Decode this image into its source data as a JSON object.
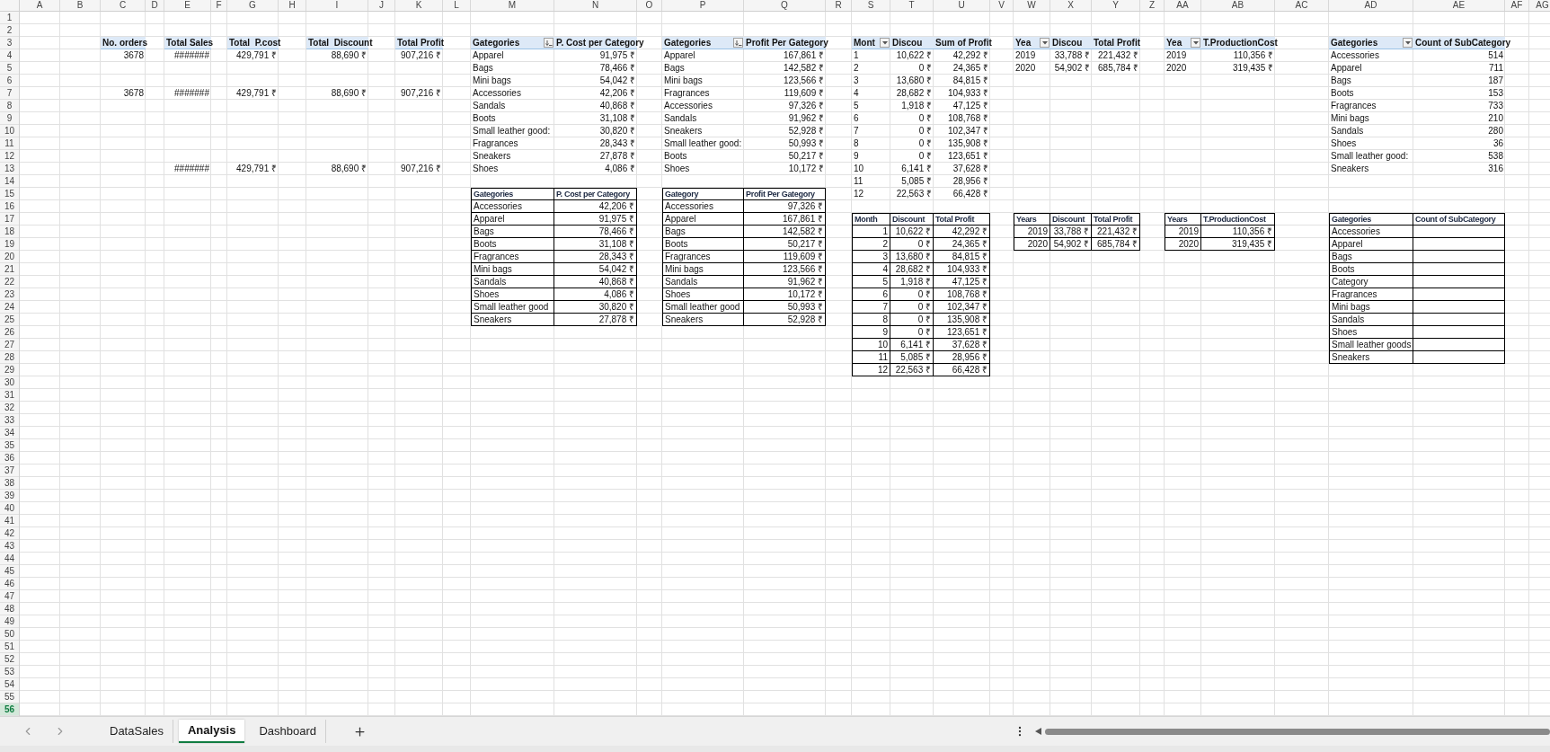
{
  "sheet": {
    "columns": [
      "A",
      "B",
      "C",
      "D",
      "E",
      "F",
      "G",
      "H",
      "I",
      "J",
      "K",
      "L",
      "M",
      "N",
      "O",
      "P",
      "Q",
      "R",
      "S",
      "T",
      "U",
      "V",
      "W",
      "X",
      "Y",
      "Z",
      "AA",
      "AB",
      "AC",
      "AD",
      "AE",
      "AF",
      "AG"
    ],
    "rows": [
      {
        "label": "1",
        "selected": false
      },
      {
        "label": "2",
        "selected": false
      },
      {
        "label": "3",
        "selected": false,
        "cells": [
          null,
          null,
          {
            "text": "No. orders",
            "kind": "heading"
          },
          null,
          {
            "text": "Total Sales",
            "kind": "heading"
          },
          null,
          {
            "text": "Total  P.cost",
            "kind": "heading"
          },
          null,
          {
            "text": "Total  Discount",
            "kind": "heading"
          },
          null,
          {
            "text": "Total Profit",
            "kind": "heading"
          },
          null,
          {
            "text": "Gategories",
            "kind": "sort-heading"
          },
          {
            "text": "P. Cost per Category",
            "kind": "heading"
          },
          null,
          {
            "text": "Gategories",
            "kind": "sort-heading"
          },
          {
            "text": "Profit Per Gategory",
            "kind": "heading"
          },
          null,
          {
            "text": "Mont",
            "kind": "filter-heading"
          },
          {
            "text": "Discou",
            "kind": "heading"
          },
          {
            "text": "Sum of Profit",
            "kind": "heading"
          },
          null,
          {
            "text": "Yea",
            "kind": "filter-heading"
          },
          {
            "text": "Discou",
            "kind": "heading"
          },
          {
            "text": "Total Profit",
            "kind": "heading"
          },
          null,
          {
            "text": "Yea",
            "kind": "filter-heading"
          },
          {
            "text": "T.ProductionCost",
            "kind": "heading"
          },
          null,
          {
            "text": "Gategories",
            "kind": "filter-heading"
          },
          {
            "text": "Count of SubCategory",
            "kind": "heading"
          }
        ]
      },
      {
        "label": "4",
        "selected": false,
        "cells": [
          null,
          null,
          {
            "text": "3678",
            "kind": "number"
          },
          null,
          {
            "text": "#######",
            "kind": "number"
          },
          null,
          {
            "text": "429,791 ₹",
            "kind": "number"
          },
          null,
          {
            "text": "88,690 ₹",
            "kind": "number"
          },
          null,
          {
            "text": "907,216 ₹",
            "kind": "number"
          },
          null,
          {
            "text": "Apparel",
            "kind": "text"
          },
          {
            "text": "91,975 ₹",
            "kind": "number"
          },
          null,
          {
            "text": "Apparel",
            "kind": "text"
          },
          {
            "text": "167,861 ₹",
            "kind": "number"
          },
          null,
          {
            "text": "1",
            "kind": "text"
          },
          {
            "text": "10,622 ₹",
            "kind": "number"
          },
          {
            "text": "42,292 ₹",
            "kind": "number"
          },
          null,
          {
            "text": "2019",
            "kind": "text"
          },
          {
            "text": "33,788 ₹",
            "kind": "number"
          },
          {
            "text": "221,432 ₹",
            "kind": "number"
          },
          null,
          {
            "text": "2019",
            "kind": "text"
          },
          {
            "text": "110,356 ₹",
            "kind": "number"
          },
          null,
          {
            "text": "Accessories",
            "kind": "text"
          },
          {
            "text": "514",
            "kind": "number"
          }
        ]
      },
      {
        "label": "5",
        "selected": false,
        "cells": [
          null,
          null,
          null,
          null,
          null,
          null,
          null,
          null,
          null,
          null,
          null,
          null,
          {
            "text": "Bags",
            "kind": "text"
          },
          {
            "text": "78,466 ₹",
            "kind": "number"
          },
          null,
          {
            "text": "Bags",
            "kind": "text"
          },
          {
            "text": "142,582 ₹",
            "kind": "number"
          },
          null,
          {
            "text": "2",
            "kind": "text"
          },
          {
            "text": "0 ₹",
            "kind": "number"
          },
          {
            "text": "24,365 ₹",
            "kind": "number"
          },
          null,
          {
            "text": "2020",
            "kind": "text"
          },
          {
            "text": "54,902 ₹",
            "kind": "number"
          },
          {
            "text": "685,784 ₹",
            "kind": "number"
          },
          null,
          {
            "text": "2020",
            "kind": "text"
          },
          {
            "text": "319,435 ₹",
            "kind": "number"
          },
          null,
          {
            "text": "Apparel",
            "kind": "text"
          },
          {
            "text": "711",
            "kind": "number"
          }
        ]
      },
      {
        "label": "6",
        "selected": false,
        "cells": [
          null,
          null,
          null,
          null,
          null,
          null,
          null,
          null,
          null,
          null,
          null,
          null,
          {
            "text": "Mini bags",
            "kind": "text"
          },
          {
            "text": "54,042 ₹",
            "kind": "number"
          },
          null,
          {
            "text": "Mini bags",
            "kind": "text"
          },
          {
            "text": "123,566 ₹",
            "kind": "number"
          },
          null,
          {
            "text": "3",
            "kind": "text"
          },
          {
            "text": "13,680 ₹",
            "kind": "number"
          },
          {
            "text": "84,815 ₹",
            "kind": "number"
          },
          null,
          null,
          null,
          null,
          null,
          null,
          null,
          null,
          {
            "text": "Bags",
            "kind": "text"
          },
          {
            "text": "187",
            "kind": "number"
          }
        ]
      },
      {
        "label": "7",
        "selected": false,
        "cells": [
          null,
          null,
          {
            "text": "3678",
            "kind": "number"
          },
          null,
          {
            "text": "#######",
            "kind": "number"
          },
          null,
          {
            "text": "429,791 ₹",
            "kind": "number"
          },
          null,
          {
            "text": "88,690 ₹",
            "kind": "number"
          },
          null,
          {
            "text": "907,216 ₹",
            "kind": "number"
          },
          null,
          {
            "text": "Accessories",
            "kind": "text"
          },
          {
            "text": "42,206 ₹",
            "kind": "number"
          },
          null,
          {
            "text": "Fragrances",
            "kind": "text"
          },
          {
            "text": "119,609 ₹",
            "kind": "number"
          },
          null,
          {
            "text": "4",
            "kind": "text"
          },
          {
            "text": "28,682 ₹",
            "kind": "number"
          },
          {
            "text": "104,933 ₹",
            "kind": "number"
          },
          null,
          null,
          null,
          null,
          null,
          null,
          null,
          null,
          {
            "text": "Boots",
            "kind": "text"
          },
          {
            "text": "153",
            "kind": "number"
          }
        ]
      },
      {
        "label": "8",
        "selected": false,
        "cells": [
          null,
          null,
          null,
          null,
          null,
          null,
          null,
          null,
          null,
          null,
          null,
          null,
          {
            "text": "Sandals",
            "kind": "text"
          },
          {
            "text": "40,868 ₹",
            "kind": "number"
          },
          null,
          {
            "text": "Accessories",
            "kind": "text"
          },
          {
            "text": "97,326 ₹",
            "kind": "number"
          },
          null,
          {
            "text": "5",
            "kind": "text"
          },
          {
            "text": "1,918 ₹",
            "kind": "number"
          },
          {
            "text": "47,125 ₹",
            "kind": "number"
          },
          null,
          null,
          null,
          null,
          null,
          null,
          null,
          null,
          {
            "text": "Fragrances",
            "kind": "text"
          },
          {
            "text": "733",
            "kind": "number"
          }
        ]
      },
      {
        "label": "9",
        "selected": false,
        "cells": [
          null,
          null,
          null,
          null,
          null,
          null,
          null,
          null,
          null,
          null,
          null,
          null,
          {
            "text": "Boots",
            "kind": "text"
          },
          {
            "text": "31,108 ₹",
            "kind": "number"
          },
          null,
          {
            "text": "Sandals",
            "kind": "text"
          },
          {
            "text": "91,962 ₹",
            "kind": "number"
          },
          null,
          {
            "text": "6",
            "kind": "text"
          },
          {
            "text": "0 ₹",
            "kind": "number"
          },
          {
            "text": "108,768 ₹",
            "kind": "number"
          },
          null,
          null,
          null,
          null,
          null,
          null,
          null,
          null,
          {
            "text": "Mini bags",
            "kind": "text"
          },
          {
            "text": "210",
            "kind": "number"
          }
        ]
      },
      {
        "label": "10",
        "selected": false,
        "cells": [
          null,
          null,
          null,
          null,
          null,
          null,
          null,
          null,
          null,
          null,
          null,
          null,
          {
            "text": "Small leather good:",
            "kind": "text"
          },
          {
            "text": "30,820 ₹",
            "kind": "number"
          },
          null,
          {
            "text": "Sneakers",
            "kind": "text"
          },
          {
            "text": "52,928 ₹",
            "kind": "number"
          },
          null,
          {
            "text": "7",
            "kind": "text"
          },
          {
            "text": "0 ₹",
            "kind": "number"
          },
          {
            "text": "102,347 ₹",
            "kind": "number"
          },
          null,
          null,
          null,
          null,
          null,
          null,
          null,
          null,
          {
            "text": "Sandals",
            "kind": "text"
          },
          {
            "text": "280",
            "kind": "number"
          }
        ]
      },
      {
        "label": "11",
        "selected": false,
        "cells": [
          null,
          null,
          null,
          null,
          null,
          null,
          null,
          null,
          null,
          null,
          null,
          null,
          {
            "text": "Fragrances",
            "kind": "text"
          },
          {
            "text": "28,343 ₹",
            "kind": "number"
          },
          null,
          {
            "text": "Small leather good:",
            "kind": "text"
          },
          {
            "text": "50,993 ₹",
            "kind": "number"
          },
          null,
          {
            "text": "8",
            "kind": "text"
          },
          {
            "text": "0 ₹",
            "kind": "number"
          },
          {
            "text": "135,908 ₹",
            "kind": "number"
          },
          null,
          null,
          null,
          null,
          null,
          null,
          null,
          null,
          {
            "text": "Shoes",
            "kind": "text"
          },
          {
            "text": "36",
            "kind": "number"
          }
        ]
      },
      {
        "label": "12",
        "selected": false,
        "cells": [
          null,
          null,
          null,
          null,
          null,
          null,
          null,
          null,
          null,
          null,
          null,
          null,
          {
            "text": "Sneakers",
            "kind": "text"
          },
          {
            "text": "27,878 ₹",
            "kind": "number"
          },
          null,
          {
            "text": "Boots",
            "kind": "text"
          },
          {
            "text": "50,217 ₹",
            "kind": "number"
          },
          null,
          {
            "text": "9",
            "kind": "text"
          },
          {
            "text": "0 ₹",
            "kind": "number"
          },
          {
            "text": "123,651 ₹",
            "kind": "number"
          },
          null,
          null,
          null,
          null,
          null,
          null,
          null,
          null,
          {
            "text": "Small leather good:",
            "kind": "text"
          },
          {
            "text": "538",
            "kind": "number"
          }
        ]
      },
      {
        "label": "13",
        "selected": false,
        "cells": [
          null,
          null,
          null,
          null,
          {
            "text": "#######",
            "kind": "number"
          },
          null,
          {
            "text": "429,791 ₹",
            "kind": "number"
          },
          null,
          {
            "text": "88,690 ₹",
            "kind": "number"
          },
          null,
          {
            "text": "907,216 ₹",
            "kind": "number"
          },
          null,
          {
            "text": "Shoes",
            "kind": "text"
          },
          {
            "text": "4,086 ₹",
            "kind": "number"
          },
          null,
          {
            "text": "Shoes",
            "kind": "text"
          },
          {
            "text": "10,172 ₹",
            "kind": "number"
          },
          null,
          {
            "text": "10",
            "kind": "text"
          },
          {
            "text": "6,141 ₹",
            "kind": "number"
          },
          {
            "text": "37,628 ₹",
            "kind": "number"
          },
          null,
          null,
          null,
          null,
          null,
          null,
          null,
          null,
          {
            "text": "Sneakers",
            "kind": "text"
          },
          {
            "text": "316",
            "kind": "number"
          }
        ]
      },
      {
        "label": "14",
        "selected": false,
        "cells": [
          null,
          null,
          null,
          null,
          null,
          null,
          null,
          null,
          null,
          null,
          null,
          null,
          null,
          null,
          null,
          null,
          null,
          null,
          {
            "text": "11",
            "kind": "text"
          },
          {
            "text": "5,085 ₹",
            "kind": "number"
          },
          {
            "text": "28,956 ₹",
            "kind": "number"
          }
        ]
      },
      {
        "label": "15",
        "selected": false,
        "cells": [
          null,
          null,
          null,
          null,
          null,
          null,
          null,
          null,
          null,
          null,
          null,
          null,
          {
            "text": "Gategories",
            "kind": "box-heading"
          },
          {
            "text": "P. Cost per Category",
            "kind": "box-heading"
          },
          null,
          {
            "text": "Gategory",
            "kind": "box-heading"
          },
          {
            "text": "Profit Per Gategory",
            "kind": "box-heading"
          },
          null,
          {
            "text": "12",
            "kind": "text"
          },
          {
            "text": "22,563 ₹",
            "kind": "number"
          },
          {
            "text": "66,428 ₹",
            "kind": "number"
          }
        ]
      },
      {
        "label": "16",
        "selected": false,
        "cells": [
          null,
          null,
          null,
          null,
          null,
          null,
          null,
          null,
          null,
          null,
          null,
          null,
          {
            "text": "Accessories",
            "kind": "box-text"
          },
          {
            "text": "42,206 ₹",
            "kind": "box-number"
          },
          null,
          {
            "text": "Accessories",
            "kind": "box-text"
          },
          {
            "text": "97,326 ₹",
            "kind": "box-number"
          }
        ]
      },
      {
        "label": "17",
        "selected": false,
        "cells": [
          null,
          null,
          null,
          null,
          null,
          null,
          null,
          null,
          null,
          null,
          null,
          null,
          {
            "text": "Apparel",
            "kind": "box-text"
          },
          {
            "text": "91,975 ₹",
            "kind": "box-number"
          },
          null,
          {
            "text": "Apparel",
            "kind": "box-text"
          },
          {
            "text": "167,861 ₹",
            "kind": "box-number"
          },
          null,
          {
            "text": "Month",
            "kind": "box-heading"
          },
          {
            "text": "Discount",
            "kind": "box-heading"
          },
          {
            "text": "Total Profit",
            "kind": "box-heading"
          },
          null,
          {
            "text": "Years",
            "kind": "box-heading"
          },
          {
            "text": "Discount",
            "kind": "box-heading"
          },
          {
            "text": "Total Profit",
            "kind": "box-heading"
          },
          null,
          {
            "text": "Years",
            "kind": "box-heading"
          },
          {
            "text": "T.ProductionCost",
            "kind": "box-heading"
          },
          null,
          {
            "text": "Gategories",
            "kind": "box-heading"
          },
          {
            "text": "Count of SubCategory",
            "kind": "box-heading"
          }
        ]
      },
      {
        "label": "18",
        "selected": false,
        "cells": [
          null,
          null,
          null,
          null,
          null,
          null,
          null,
          null,
          null,
          null,
          null,
          null,
          {
            "text": "Bags",
            "kind": "box-text"
          },
          {
            "text": "78,466 ₹",
            "kind": "box-number"
          },
          null,
          {
            "text": "Bags",
            "kind": "box-text"
          },
          {
            "text": "142,582 ₹",
            "kind": "box-number"
          },
          null,
          {
            "text": "1",
            "kind": "box-number"
          },
          {
            "text": "10,622 ₹",
            "kind": "box-number"
          },
          {
            "text": "42,292 ₹",
            "kind": "box-number"
          },
          null,
          {
            "text": "2019",
            "kind": "box-number"
          },
          {
            "text": "33,788 ₹",
            "kind": "box-number"
          },
          {
            "text": "221,432 ₹",
            "kind": "box-number"
          },
          null,
          {
            "text": "2019",
            "kind": "box-number"
          },
          {
            "text": "110,356 ₹",
            "kind": "box-number"
          },
          null,
          {
            "text": "Accessories",
            "kind": "box-text"
          },
          {
            "kind": "box-empty"
          }
        ]
      },
      {
        "label": "19",
        "selected": false,
        "cells": [
          null,
          null,
          null,
          null,
          null,
          null,
          null,
          null,
          null,
          null,
          null,
          null,
          {
            "text": "Boots",
            "kind": "box-text"
          },
          {
            "text": "31,108 ₹",
            "kind": "box-number"
          },
          null,
          {
            "text": "Boots",
            "kind": "box-text"
          },
          {
            "text": "50,217 ₹",
            "kind": "box-number"
          },
          null,
          {
            "text": "2",
            "kind": "box-number"
          },
          {
            "text": "0 ₹",
            "kind": "box-number"
          },
          {
            "text": "24,365 ₹",
            "kind": "box-number"
          },
          null,
          {
            "text": "2020",
            "kind": "box-number"
          },
          {
            "text": "54,902 ₹",
            "kind": "box-number"
          },
          {
            "text": "685,784 ₹",
            "kind": "box-number"
          },
          null,
          {
            "text": "2020",
            "kind": "box-number"
          },
          {
            "text": "319,435 ₹",
            "kind": "box-number"
          },
          null,
          {
            "text": "Apparel",
            "kind": "box-text"
          },
          {
            "kind": "box-empty"
          }
        ]
      },
      {
        "label": "20",
        "selected": false,
        "cells": [
          null,
          null,
          null,
          null,
          null,
          null,
          null,
          null,
          null,
          null,
          null,
          null,
          {
            "text": "Fragrances",
            "kind": "box-text"
          },
          {
            "text": "28,343 ₹",
            "kind": "box-number"
          },
          null,
          {
            "text": "Fragrances",
            "kind": "box-text"
          },
          {
            "text": "119,609 ₹",
            "kind": "box-number"
          },
          null,
          {
            "text": "3",
            "kind": "box-number"
          },
          {
            "text": "13,680 ₹",
            "kind": "box-number"
          },
          {
            "text": "84,815 ₹",
            "kind": "box-number"
          },
          null,
          null,
          null,
          null,
          null,
          null,
          null,
          null,
          {
            "text": "Bags",
            "kind": "box-text"
          },
          {
            "kind": "box-empty"
          }
        ]
      },
      {
        "label": "21",
        "selected": false,
        "cells": [
          null,
          null,
          null,
          null,
          null,
          null,
          null,
          null,
          null,
          null,
          null,
          null,
          {
            "text": "Mini bags",
            "kind": "box-text"
          },
          {
            "text": "54,042 ₹",
            "kind": "box-number"
          },
          null,
          {
            "text": "Mini bags",
            "kind": "box-text"
          },
          {
            "text": "123,566 ₹",
            "kind": "box-number"
          },
          null,
          {
            "text": "4",
            "kind": "box-number"
          },
          {
            "text": "28,682 ₹",
            "kind": "box-number"
          },
          {
            "text": "104,933 ₹",
            "kind": "box-number"
          },
          null,
          null,
          null,
          null,
          null,
          null,
          null,
          null,
          {
            "text": "Boots",
            "kind": "box-text"
          },
          {
            "kind": "box-empty"
          }
        ]
      },
      {
        "label": "22",
        "selected": false,
        "cells": [
          null,
          null,
          null,
          null,
          null,
          null,
          null,
          null,
          null,
          null,
          null,
          null,
          {
            "text": "Sandals",
            "kind": "box-text"
          },
          {
            "text": "40,868 ₹",
            "kind": "box-number"
          },
          null,
          {
            "text": "Sandals",
            "kind": "box-text"
          },
          {
            "text": "91,962 ₹",
            "kind": "box-number"
          },
          null,
          {
            "text": "5",
            "kind": "box-number"
          },
          {
            "text": "1,918 ₹",
            "kind": "box-number"
          },
          {
            "text": "47,125 ₹",
            "kind": "box-number"
          },
          null,
          null,
          null,
          null,
          null,
          null,
          null,
          null,
          {
            "text": "Category",
            "kind": "box-text"
          },
          {
            "kind": "box-empty"
          }
        ]
      },
      {
        "label": "23",
        "selected": false,
        "cells": [
          null,
          null,
          null,
          null,
          null,
          null,
          null,
          null,
          null,
          null,
          null,
          null,
          {
            "text": "Shoes",
            "kind": "box-text"
          },
          {
            "text": "4,086 ₹",
            "kind": "box-number"
          },
          null,
          {
            "text": "Shoes",
            "kind": "box-text"
          },
          {
            "text": "10,172 ₹",
            "kind": "box-number"
          },
          null,
          {
            "text": "6",
            "kind": "box-number"
          },
          {
            "text": "0 ₹",
            "kind": "box-number"
          },
          {
            "text": "108,768 ₹",
            "kind": "box-number"
          },
          null,
          null,
          null,
          null,
          null,
          null,
          null,
          null,
          {
            "text": "Fragrances",
            "kind": "box-text"
          },
          {
            "kind": "box-empty"
          }
        ]
      },
      {
        "label": "24",
        "selected": false,
        "cells": [
          null,
          null,
          null,
          null,
          null,
          null,
          null,
          null,
          null,
          null,
          null,
          null,
          {
            "text": "Small leather good",
            "kind": "box-text"
          },
          {
            "text": "30,820 ₹",
            "kind": "box-number"
          },
          null,
          {
            "text": "Small leather good",
            "kind": "box-text"
          },
          {
            "text": "50,993 ₹",
            "kind": "box-number"
          },
          null,
          {
            "text": "7",
            "kind": "box-number"
          },
          {
            "text": "0 ₹",
            "kind": "box-number"
          },
          {
            "text": "102,347 ₹",
            "kind": "box-number"
          },
          null,
          null,
          null,
          null,
          null,
          null,
          null,
          null,
          {
            "text": "Mini bags",
            "kind": "box-text"
          },
          {
            "kind": "box-empty"
          }
        ]
      },
      {
        "label": "25",
        "selected": false,
        "cells": [
          null,
          null,
          null,
          null,
          null,
          null,
          null,
          null,
          null,
          null,
          null,
          null,
          {
            "text": "Sneakers",
            "kind": "box-text"
          },
          {
            "text": "27,878 ₹",
            "kind": "box-number"
          },
          null,
          {
            "text": "Sneakers",
            "kind": "box-text"
          },
          {
            "text": "52,928 ₹",
            "kind": "box-number"
          },
          null,
          {
            "text": "8",
            "kind": "box-number"
          },
          {
            "text": "0 ₹",
            "kind": "box-number"
          },
          {
            "text": "135,908 ₹",
            "kind": "box-number"
          },
          null,
          null,
          null,
          null,
          null,
          null,
          null,
          null,
          {
            "text": "Sandals",
            "kind": "box-text"
          },
          {
            "kind": "box-empty"
          }
        ]
      },
      {
        "label": "26",
        "selected": false,
        "cells": [
          null,
          null,
          null,
          null,
          null,
          null,
          null,
          null,
          null,
          null,
          null,
          null,
          null,
          null,
          null,
          null,
          null,
          null,
          {
            "text": "9",
            "kind": "box-number"
          },
          {
            "text": "0 ₹",
            "kind": "box-number"
          },
          {
            "text": "123,651 ₹",
            "kind": "box-number"
          },
          null,
          null,
          null,
          null,
          null,
          null,
          null,
          null,
          {
            "text": "Shoes",
            "kind": "box-text"
          },
          {
            "kind": "box-empty"
          }
        ]
      },
      {
        "label": "27",
        "selected": false,
        "cells": [
          null,
          null,
          null,
          null,
          null,
          null,
          null,
          null,
          null,
          null,
          null,
          null,
          null,
          null,
          null,
          null,
          null,
          null,
          {
            "text": "10",
            "kind": "box-number"
          },
          {
            "text": "6,141 ₹",
            "kind": "box-number"
          },
          {
            "text": "37,628 ₹",
            "kind": "box-number"
          },
          null,
          null,
          null,
          null,
          null,
          null,
          null,
          null,
          {
            "text": "Small leather goods",
            "kind": "box-text"
          },
          {
            "kind": "box-empty"
          }
        ]
      },
      {
        "label": "28",
        "selected": false,
        "cells": [
          null,
          null,
          null,
          null,
          null,
          null,
          null,
          null,
          null,
          null,
          null,
          null,
          null,
          null,
          null,
          null,
          null,
          null,
          {
            "text": "11",
            "kind": "box-number"
          },
          {
            "text": "5,085 ₹",
            "kind": "box-number"
          },
          {
            "text": "28,956 ₹",
            "kind": "box-number"
          },
          null,
          null,
          null,
          null,
          null,
          null,
          null,
          null,
          {
            "text": "Sneakers",
            "kind": "box-text"
          },
          {
            "kind": "box-empty"
          }
        ]
      },
      {
        "label": "29",
        "selected": false,
        "cells": [
          null,
          null,
          null,
          null,
          null,
          null,
          null,
          null,
          null,
          null,
          null,
          null,
          null,
          null,
          null,
          null,
          null,
          null,
          {
            "text": "12",
            "kind": "box-number"
          },
          {
            "text": "22,563 ₹",
            "kind": "box-number"
          },
          {
            "text": "66,428 ₹",
            "kind": "box-number"
          }
        ]
      },
      {
        "label": "30",
        "selected": false
      },
      {
        "label": "31",
        "selected": false
      },
      {
        "label": "32",
        "selected": false
      },
      {
        "label": "33",
        "selected": false
      },
      {
        "label": "34",
        "selected": false
      },
      {
        "label": "35",
        "selected": false
      },
      {
        "label": "36",
        "selected": false
      },
      {
        "label": "37",
        "selected": false
      },
      {
        "label": "38",
        "selected": false
      },
      {
        "label": "39",
        "selected": false
      },
      {
        "label": "40",
        "selected": false
      },
      {
        "label": "41",
        "selected": false
      },
      {
        "label": "42",
        "selected": false
      },
      {
        "label": "43",
        "selected": false
      },
      {
        "label": "44",
        "selected": false
      },
      {
        "label": "45",
        "selected": false
      },
      {
        "label": "46",
        "selected": false
      },
      {
        "label": "47",
        "selected": false
      },
      {
        "label": "48",
        "selected": false
      },
      {
        "label": "49",
        "selected": false
      },
      {
        "label": "50",
        "selected": false
      },
      {
        "label": "51",
        "selected": false
      },
      {
        "label": "52",
        "selected": false
      },
      {
        "label": "53",
        "selected": false
      },
      {
        "label": "54",
        "selected": false
      },
      {
        "label": "55",
        "selected": false
      },
      {
        "label": "56",
        "selected": true
      }
    ]
  },
  "sheet_tabs": [
    {
      "label": "DataSales",
      "selected": false
    },
    {
      "label": "Analysis",
      "selected": true
    },
    {
      "label": "Dashboard",
      "selected": false
    }
  ]
}
